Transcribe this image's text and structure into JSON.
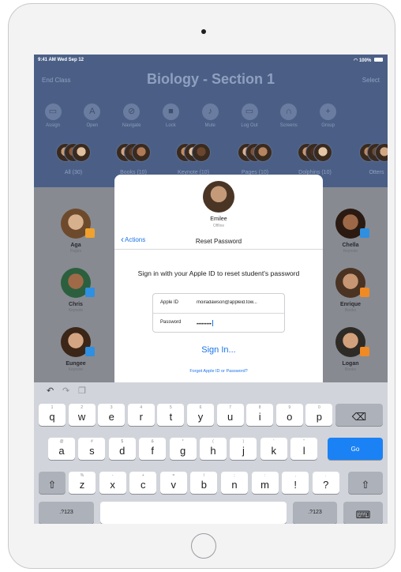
{
  "status_bar": {
    "time": "9:41 AM  Wed Sep 12",
    "battery": "100%"
  },
  "header": {
    "left_button": "End Class",
    "title": "Biology - Section 1",
    "right_button": "Select"
  },
  "tools": [
    {
      "label": "Assign",
      "icon": "assign-icon",
      "glyph": "▭"
    },
    {
      "label": "Open",
      "icon": "open-icon",
      "glyph": "A"
    },
    {
      "label": "Navigate",
      "icon": "navigate-icon",
      "glyph": "⊘"
    },
    {
      "label": "Lock",
      "icon": "lock-icon",
      "glyph": "■"
    },
    {
      "label": "Mute",
      "icon": "mute-icon",
      "glyph": "♪"
    },
    {
      "label": "Log Out",
      "icon": "logout-icon",
      "glyph": "▭"
    },
    {
      "label": "Screens",
      "icon": "screens-icon",
      "glyph": "∩"
    },
    {
      "label": "Group",
      "icon": "group-icon",
      "glyph": "+"
    }
  ],
  "groups": [
    {
      "label": "All (30)"
    },
    {
      "label": "Books (10)"
    },
    {
      "label": "Keynote (10)"
    },
    {
      "label": "Pages (10)"
    },
    {
      "label": "Dolphins (10)"
    },
    {
      "label": "Otters"
    }
  ],
  "students": [
    {
      "name": "Aga",
      "app": "Pages"
    },
    {
      "name": "Chris",
      "app": "Keynote"
    },
    {
      "name": "Eungee",
      "app": "Keynote"
    },
    {
      "name": "Chella",
      "app": "Keynote"
    },
    {
      "name": "Enrique",
      "app": "Books"
    },
    {
      "name": "Logan",
      "app": "Books"
    }
  ],
  "popover": {
    "student_name": "Emilee",
    "student_status": "Offline",
    "back_label": "Actions",
    "title": "Reset Password",
    "instruction": "Sign in with your Apple ID to reset student's password",
    "apple_id_label": "Apple ID",
    "apple_id_value": "moiradawson@appleid.tow...",
    "password_label": "Password",
    "password_value": "•••••••••",
    "sign_in_label": "Sign In...",
    "forgot_label": "Forgot Apple ID or Password?"
  },
  "keyboard": {
    "row1": [
      {
        "main": "q",
        "alt": "1"
      },
      {
        "main": "w",
        "alt": "2"
      },
      {
        "main": "e",
        "alt": "3"
      },
      {
        "main": "r",
        "alt": "4"
      },
      {
        "main": "t",
        "alt": "5"
      },
      {
        "main": "y",
        "alt": "6"
      },
      {
        "main": "u",
        "alt": "7"
      },
      {
        "main": "i",
        "alt": "8"
      },
      {
        "main": "o",
        "alt": "9"
      },
      {
        "main": "p",
        "alt": "0"
      }
    ],
    "row2": [
      {
        "main": "a",
        "alt": "@"
      },
      {
        "main": "s",
        "alt": "#"
      },
      {
        "main": "d",
        "alt": "$"
      },
      {
        "main": "f",
        "alt": "&"
      },
      {
        "main": "g",
        "alt": "*"
      },
      {
        "main": "h",
        "alt": "("
      },
      {
        "main": "j",
        "alt": ")"
      },
      {
        "main": "k",
        "alt": "'"
      },
      {
        "main": "l",
        "alt": "\""
      }
    ],
    "row3": [
      {
        "main": "z",
        "alt": "%"
      },
      {
        "main": "x",
        "alt": "-"
      },
      {
        "main": "c",
        "alt": "+"
      },
      {
        "main": "v",
        "alt": "="
      },
      {
        "main": "b",
        "alt": "/"
      },
      {
        "main": "n",
        "alt": ";"
      },
      {
        "main": "m",
        "alt": ":"
      },
      {
        "main": "!",
        "alt": ","
      },
      {
        "main": "?",
        "alt": "."
      }
    ],
    "go_label": "Go",
    "numbers_label": ".?123",
    "numbers_label_right": ".?123"
  },
  "colors": {
    "accent": "#1a73e8",
    "header_bg": "#4b5f86",
    "keyboard_bg": "#d1d4da",
    "go_key": "#1a82f5"
  }
}
